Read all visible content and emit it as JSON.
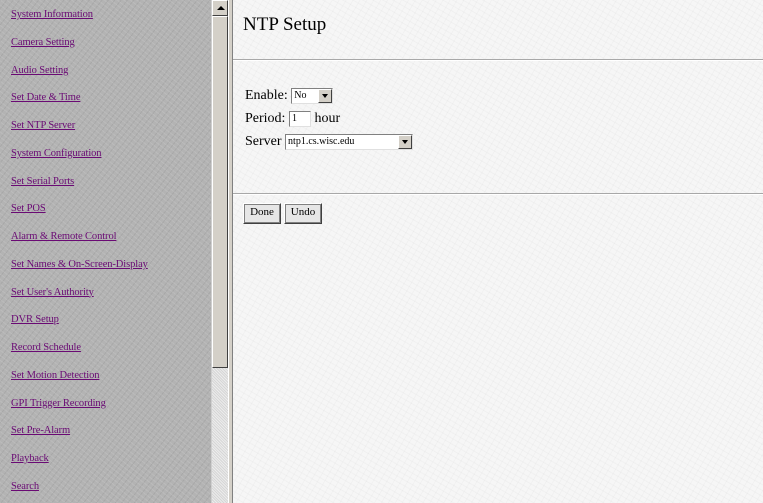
{
  "sidebar": {
    "items": [
      {
        "label": "System Information"
      },
      {
        "label": "Camera Setting"
      },
      {
        "label": "Audio Setting"
      },
      {
        "label": "Set Date & Time"
      },
      {
        "label": "Set NTP Server"
      },
      {
        "label": "System Configuration"
      },
      {
        "label": "Set Serial Ports"
      },
      {
        "label": "Set POS"
      },
      {
        "label": "Alarm & Remote Control"
      },
      {
        "label": "Set Names & On-Screen-Display"
      },
      {
        "label": "Set User's Authority"
      },
      {
        "label": "DVR Setup"
      },
      {
        "label": "Record Schedule"
      },
      {
        "label": "Set Motion Detection"
      },
      {
        "label": "GPI Trigger Recording"
      },
      {
        "label": "Set Pre-Alarm"
      },
      {
        "label": "Playback"
      },
      {
        "label": "Search"
      }
    ]
  },
  "main": {
    "title": "NTP Setup",
    "form": {
      "enable_label": "Enable:",
      "enable_value": "No",
      "period_label": "Period:",
      "period_value": "1",
      "period_unit": "hour",
      "server_label": "Server",
      "server_value": "ntp1.cs.wisc.edu"
    },
    "buttons": {
      "done": "Done",
      "undo": "Undo"
    }
  },
  "colors": {
    "link": "#6a0a74",
    "sidebar_bg": "#b3b3b3",
    "content_bg": "#f6f6f6"
  }
}
